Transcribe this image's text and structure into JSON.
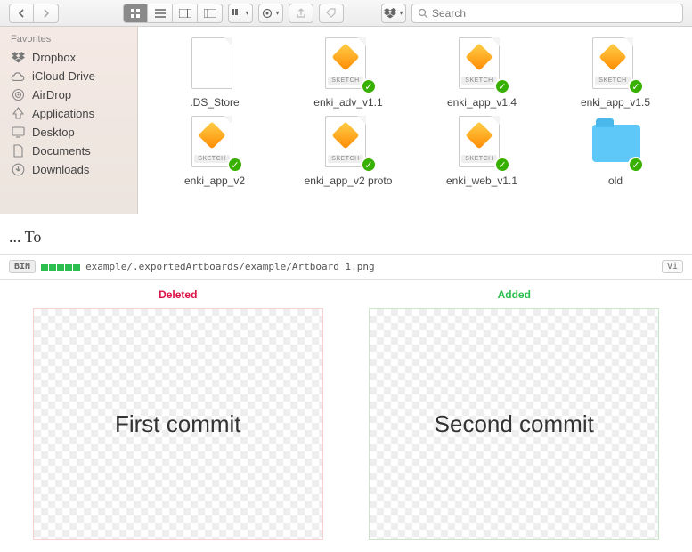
{
  "toolbar": {
    "search_placeholder": "Search"
  },
  "sidebar": {
    "header": "Favorites",
    "items": [
      {
        "label": "Dropbox",
        "icon": "dropbox-icon"
      },
      {
        "label": "iCloud Drive",
        "icon": "cloud-icon"
      },
      {
        "label": "AirDrop",
        "icon": "airdrop-icon"
      },
      {
        "label": "Applications",
        "icon": "apps-icon"
      },
      {
        "label": "Desktop",
        "icon": "desktop-icon"
      },
      {
        "label": "Documents",
        "icon": "documents-icon"
      },
      {
        "label": "Downloads",
        "icon": "download-icon"
      }
    ]
  },
  "files": [
    {
      "label": ".DS_Store",
      "kind": "blank",
      "synced": false
    },
    {
      "label": "enki_adv_v1.1",
      "kind": "sketch",
      "synced": true
    },
    {
      "label": "enki_app_v1.4",
      "kind": "sketch",
      "synced": true
    },
    {
      "label": "enki_app_v1.5",
      "kind": "sketch",
      "synced": true
    },
    {
      "label": "enki_app_v2",
      "kind": "sketch",
      "synced": true
    },
    {
      "label": "enki_app_v2 proto",
      "kind": "sketch",
      "synced": true
    },
    {
      "label": "enki_web_v1.1",
      "kind": "sketch",
      "synced": true
    },
    {
      "label": "old",
      "kind": "folder",
      "synced": true
    }
  ],
  "file_tag": "SKETCH",
  "section_label": "... To",
  "diff": {
    "bin_label": "BIN",
    "path": "example/.exportedArtboards/example/Artboard 1.png",
    "view_btn": "Vi",
    "deleted_label": "Deleted",
    "added_label": "Added",
    "deleted_content": "First commit",
    "added_content": "Second commit"
  }
}
